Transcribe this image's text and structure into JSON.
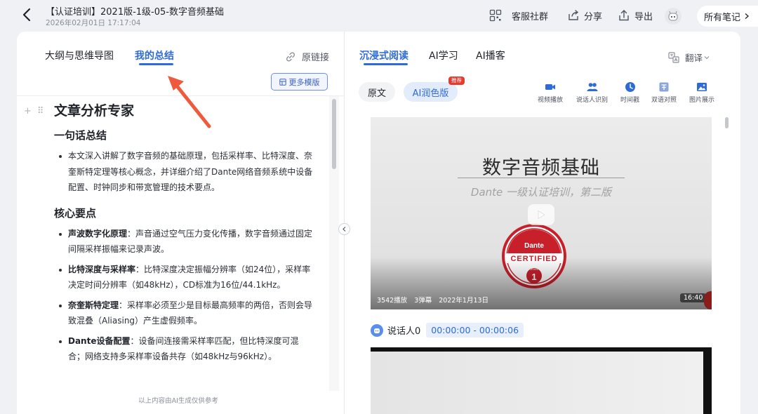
{
  "header": {
    "title": "【认证培训】2021版-1级-05-数字音频基础",
    "date": "2026年02月01日 17:17:04",
    "service_group": "客服社群",
    "share": "分享",
    "export": "导出",
    "all_notes": "所有笔记"
  },
  "left": {
    "tabs": [
      "大纲与思维导图",
      "我的总结"
    ],
    "original_link": "原链接",
    "more_templates": "更多模版",
    "article_title": "文章分析专家",
    "summary_heading": "一句话总结",
    "summary_text": "本文深入讲解了数字音频的基础原理，包括采样率、比特深度、奈奎斯特定理等核心概念，并详细介绍了Dante网络音频系统中设备配置、时钟同步和带宽管理的技术要点。",
    "key_points_heading": "核心要点",
    "key_points": [
      {
        "term": "声波数字化原理",
        "text": "：声音通过空气压力变化传播，数字音频通过固定间隔采样振幅来记录声波。"
      },
      {
        "term": "比特深度与采样率",
        "text": "：比特深度决定振幅分辨率（如24位），采样率决定时间分辨率（如48kHz），CD标准为16位/44.1kHz。"
      },
      {
        "term": "奈奎斯特定理",
        "text": "：采样率必须至少是目标最高频率的两倍，否则会导致混叠（Aliasing）产生虚假频率。"
      },
      {
        "term": "Dante设备配置",
        "text": "：设备间连接需采样率匹配，但比特深度可混合；网络支持多采样率设备共存（如48kHz与96kHz）。"
      }
    ],
    "footnote": "以上内容由AI生成仅供参考"
  },
  "right": {
    "tabs": [
      "沉浸式阅读",
      "AI学习",
      "AI播客"
    ],
    "translate": "翻译",
    "view_original": "原文",
    "view_ai": "AI润色版",
    "recommend_badge": "推荐",
    "tools": [
      "视频播放",
      "说话人识别",
      "时间戳",
      "双语对照",
      "图片展示"
    ],
    "video": {
      "title": "数字音频基础",
      "subtitle": "Dante 一级认证培训，第二版",
      "seal_brand": "Dante",
      "seal_text": "CERTIFIED",
      "seal_level": "LEVEL",
      "seal_number": "1",
      "plays": "3542播放",
      "danmaku": "3弹幕",
      "publish_date": "2022年1月13日",
      "duration": "16:40"
    },
    "speaker": "说话人0",
    "timerange": "00:00:00 - 00:00:06"
  },
  "colors": {
    "accent": "#2f6bd6",
    "arrow": "#f05a3c",
    "badge": "#e63b2e"
  }
}
